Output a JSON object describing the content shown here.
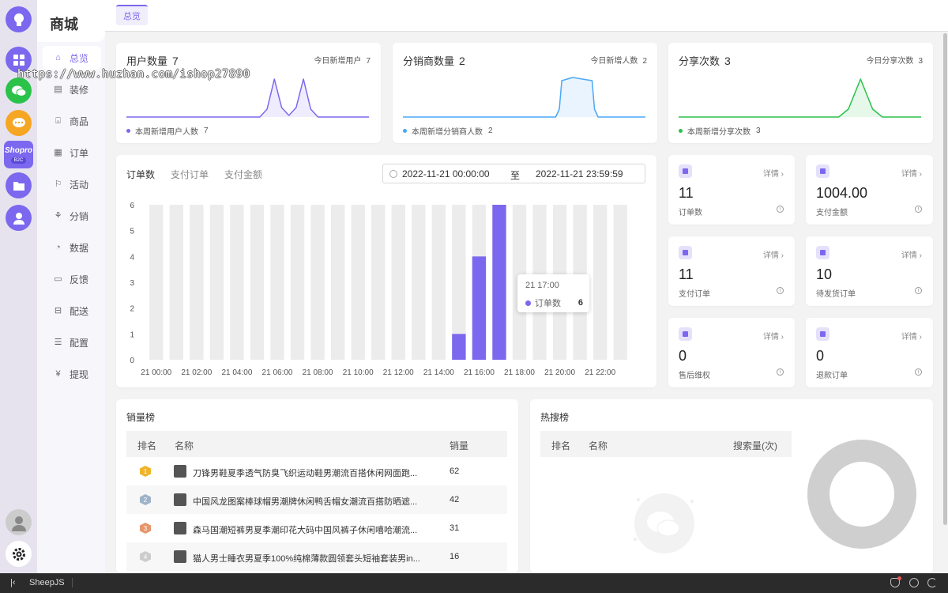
{
  "rail": {
    "store_label": "Shopro",
    "store_tag": "B2C"
  },
  "menu": {
    "brand": "商城",
    "items": [
      {
        "label": "总览",
        "icon": "home-icon"
      },
      {
        "label": "装修",
        "icon": "decorate-icon"
      },
      {
        "label": "商品",
        "icon": "shop-icon"
      },
      {
        "label": "订单",
        "icon": "order-icon"
      },
      {
        "label": "活动",
        "icon": "activity-icon"
      },
      {
        "label": "分销",
        "icon": "distribution-icon"
      },
      {
        "label": "数据",
        "icon": "data-icon"
      },
      {
        "label": "反馈",
        "icon": "feedback-icon"
      },
      {
        "label": "配送",
        "icon": "delivery-icon"
      },
      {
        "label": "配置",
        "icon": "settings-icon"
      },
      {
        "label": "提现",
        "icon": "withdraw-icon"
      }
    ]
  },
  "topbar": {
    "tab": "总览"
  },
  "watermark": "https://www.huzhan.com/ishop27890",
  "stats": [
    {
      "title": "用户数量",
      "value": "7",
      "today_label": "今日新增用户",
      "today_value": "7",
      "week_label": "本周新增用户人数",
      "week_value": "7",
      "color": "#7b68ee"
    },
    {
      "title": "分销商数量",
      "value": "2",
      "today_label": "今日新增人数",
      "today_value": "2",
      "week_label": "本周新增分销商人数",
      "week_value": "2",
      "color": "#4aa8f5"
    },
    {
      "title": "分享次数",
      "value": "3",
      "today_label": "今日分享次数",
      "today_value": "3",
      "week_label": "本周新增分享次数",
      "week_value": "3",
      "color": "#2bc24a"
    }
  ],
  "orders": {
    "tabs": [
      "订单数",
      "支付订单",
      "支付金额"
    ],
    "date_start": "2022-11-21 00:00:00",
    "date_sep": "至",
    "date_end": "2022-11-21 23:59:59",
    "tooltip": {
      "time": "21 17:00",
      "label": "订单数",
      "value": "6"
    }
  },
  "chart_data": {
    "type": "bar",
    "categories": [
      "21 00:00",
      "21 01:00",
      "21 02:00",
      "21 03:00",
      "21 04:00",
      "21 05:00",
      "21 06:00",
      "21 07:00",
      "21 08:00",
      "21 09:00",
      "21 10:00",
      "21 11:00",
      "21 12:00",
      "21 13:00",
      "21 14:00",
      "21 15:00",
      "21 16:00",
      "21 17:00",
      "21 18:00",
      "21 19:00",
      "21 20:00",
      "21 21:00",
      "21 22:00",
      "21 23:00"
    ],
    "x_tick_labels": [
      "21 00:00",
      "21 02:00",
      "21 04:00",
      "21 06:00",
      "21 08:00",
      "21 10:00",
      "21 12:00",
      "21 14:00",
      "21 16:00",
      "21 18:00",
      "21 20:00",
      "21 22:00"
    ],
    "values": [
      0,
      0,
      0,
      0,
      0,
      0,
      0,
      0,
      0,
      0,
      0,
      0,
      0,
      0,
      0,
      1,
      4,
      6,
      0,
      0,
      0,
      0,
      0,
      0
    ],
    "ylim": [
      0,
      6
    ],
    "yticks": [
      0,
      1,
      2,
      3,
      4,
      5,
      6
    ],
    "bar_color": "#7b68ee",
    "background_bar_color": "#ececec"
  },
  "minis": [
    {
      "detail": "详情",
      "value": "11",
      "label": "订单数"
    },
    {
      "detail": "详情",
      "value": "1004.00",
      "label": "支付金额"
    },
    {
      "detail": "详情",
      "value": "11",
      "label": "支付订单"
    },
    {
      "detail": "详情",
      "value": "10",
      "label": "待发货订单"
    },
    {
      "detail": "详情",
      "value": "0",
      "label": "售后维权"
    },
    {
      "detail": "详情",
      "value": "0",
      "label": "退款订单"
    }
  ],
  "sales": {
    "title": "销量榜",
    "headers": [
      "排名",
      "名称",
      "销量"
    ],
    "rows": [
      {
        "rank": "1",
        "name": "刀锋男鞋夏季透气防臭飞织运动鞋男潮流百搭休闲网面跑...",
        "sales": "62",
        "medal_color": "#f0b429"
      },
      {
        "rank": "2",
        "name": "中国风龙图案棒球帽男潮牌休闲鸭舌帽女潮流百搭防晒遮...",
        "sales": "42",
        "medal_color": "#9fb3c8"
      },
      {
        "rank": "3",
        "name": "森马国潮短裤男夏季潮印花大码中国风裤子休闲嘻哈潮流...",
        "sales": "31",
        "medal_color": "#e8956a"
      },
      {
        "rank": "4",
        "name": "猫人男士睡衣男夏季100%纯棉薄款圆领套头短袖套装男in...",
        "sales": "16",
        "medal_color": "#cccccc"
      }
    ]
  },
  "hot": {
    "title": "热搜榜",
    "headers": [
      "排名",
      "名称",
      "搜索量(次)"
    ]
  },
  "bottom": {
    "label": "SheepJS"
  }
}
